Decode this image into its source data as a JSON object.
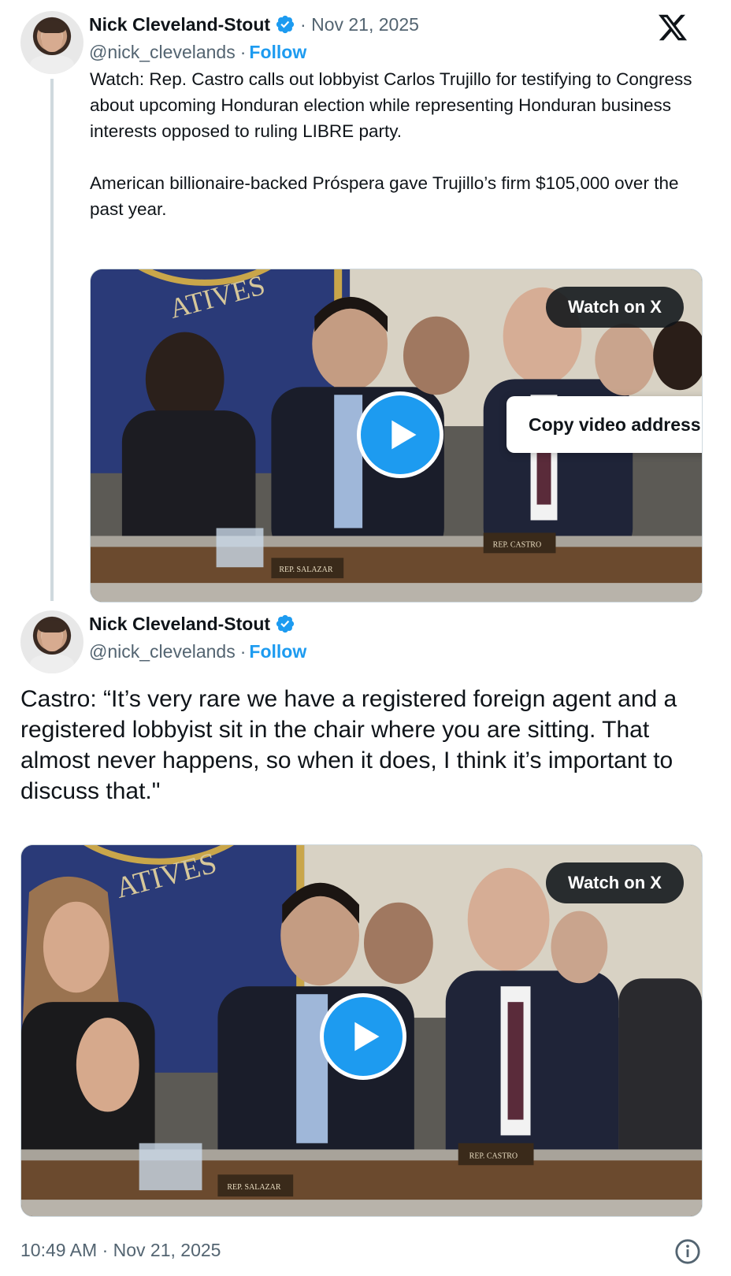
{
  "tweet1": {
    "author_name": "Nick Cleveland-Stout",
    "separator_date": "· Nov 21, 2025",
    "handle": "@nick_clevelands",
    "handle_sep": "·",
    "follow_label": "Follow",
    "text": "Watch: Rep. Castro calls out lobbyist Carlos Trujillo for testifying to Congress about upcoming Honduran election while representing Honduran business interests opposed to ruling LIBRE party.\n\nAmerican billionaire-backed Próspera gave Trujillo’s firm $105,000 over the past year.",
    "media": {
      "watch_label": "Watch on X",
      "copy_label": "Copy video address",
      "nameplates": [
        "REP. SALAZAR",
        "REP. CASTRO"
      ],
      "seal_text": "ATIVES"
    }
  },
  "tweet2": {
    "author_name": "Nick Cleveland-Stout",
    "handle": "@nick_clevelands",
    "handle_sep": "·",
    "follow_label": "Follow",
    "text": "Castro: “It’s very rare we have a registered foreign agent and a registered lobbyist sit in the chair where you are sitting. That almost never happens, so when it does, I think it’s important to discuss that.\"",
    "media": {
      "watch_label": "Watch on X",
      "nameplates": [
        "REP. SALAZAR",
        "REP. CASTRO"
      ],
      "seal_text": "ATIVES"
    }
  },
  "footer": {
    "timestamp": "10:49 AM · Nov 21, 2025"
  },
  "colors": {
    "accent": "#1d9bf0",
    "text": "#0f1419",
    "muted": "#536471"
  }
}
